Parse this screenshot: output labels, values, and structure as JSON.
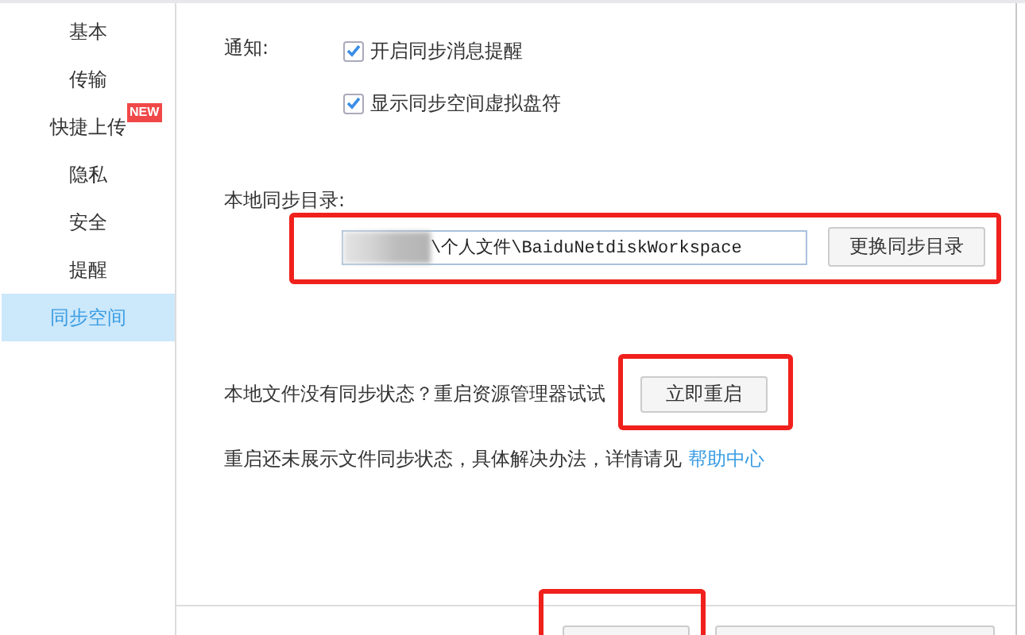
{
  "sidebar": {
    "items": [
      {
        "label": "基本",
        "selected": false
      },
      {
        "label": "传输",
        "selected": false
      },
      {
        "label": "快捷上传",
        "selected": false,
        "badge": "NEW"
      },
      {
        "label": "隐私",
        "selected": false
      },
      {
        "label": "安全",
        "selected": false
      },
      {
        "label": "提醒",
        "selected": false
      },
      {
        "label": "同步空间",
        "selected": true
      }
    ]
  },
  "notify": {
    "label": "通知:",
    "options": [
      {
        "label": "开启同步消息提醒",
        "checked": true
      },
      {
        "label": "显示同步空间虚拟盘符",
        "checked": true
      }
    ]
  },
  "sync_dir": {
    "label": "本地同步目录:",
    "path": {
      "value": "\\个人文件\\BaiduNetdiskWorkspace",
      "redacted": true
    },
    "button": "更换同步目录",
    "highlighted": true
  },
  "restart": {
    "text": "本地文件没有同步状态？重启资源管理器试试",
    "button": "立即重启",
    "highlighted": true
  },
  "help": {
    "text": "重启还未展示文件同步状态，具体解决办法，详情请见",
    "link": "帮助中心"
  },
  "footer": {
    "buttons": [
      {
        "highlighted": true
      },
      {
        "highlighted": false
      }
    ]
  }
}
